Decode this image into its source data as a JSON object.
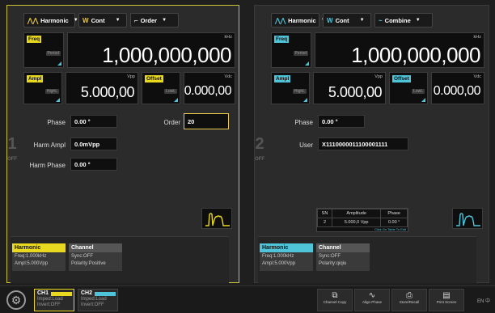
{
  "ch1": {
    "number": "1",
    "state": "OFF",
    "menus": {
      "waveform": "Harmonic",
      "mode": "Cont",
      "type": "Order"
    },
    "freq": {
      "tag": "Freq",
      "mini": "Period",
      "unit": "kHz",
      "value": "1,000,000,000"
    },
    "ampl": {
      "tag": "Ampl",
      "mini": "HighL",
      "unit": "Vpp",
      "value": "5.000,00"
    },
    "offset": {
      "tag": "Offset",
      "mini": "LowL",
      "unit": "Vdc",
      "value": "0.000,00"
    },
    "phase": {
      "label": "Phase",
      "value": "0.00 °"
    },
    "order": {
      "label": "Order",
      "value": "20"
    },
    "harm_ampl": {
      "label": "Harm Ampl",
      "value": "0.0mVpp"
    },
    "harm_phase": {
      "label": "Harm Phase",
      "value": "0.00 °"
    },
    "tab1": {
      "title": "Harmonic",
      "l1": "Freq:1.000kHz",
      "l2": "Ampl:5.000Vpp"
    },
    "tab2": {
      "title": "Channel",
      "l1": "Sync:OFF",
      "l2": "Polarity:Positive"
    }
  },
  "ch2": {
    "number": "2",
    "state": "OFF",
    "menus": {
      "waveform": "Harmonic",
      "mode": "Cont",
      "type": "Combine"
    },
    "freq": {
      "tag": "Freq",
      "mini": "Period",
      "unit": "kHz",
      "value": "1,000,000,000"
    },
    "ampl": {
      "tag": "Ampl",
      "mini": "HighL",
      "unit": "Vpp",
      "value": "5.000,00"
    },
    "offset": {
      "tag": "Offset",
      "mini": "LowL",
      "unit": "Vdc",
      "value": "0.000,00"
    },
    "phase": {
      "label": "Phase",
      "value": "0.00 °"
    },
    "user": {
      "label": "User",
      "value": "X1110000011100001111"
    },
    "table": {
      "headers": [
        "SN",
        "Amplitude",
        "Phase"
      ],
      "row": [
        "2",
        "5.000,0 Vpp",
        "0.00 °"
      ],
      "footer": "Click On Table To Edit"
    },
    "tab1": {
      "title": "Harmonic",
      "l1": "Freq:1.000kHz",
      "l2": "Ampl:5.000Vpp"
    },
    "tab2": {
      "title": "Channel",
      "l1": "Sync:OFF",
      "l2": "Polarity:qiqiu"
    }
  },
  "bottom": {
    "ch1": {
      "title": "CH1",
      "l1": "Imped:Load",
      "l2": "Invert:OFF"
    },
    "ch2": {
      "title": "CH2",
      "l1": "Imped:Load",
      "l2": "Invert:OFF"
    },
    "tools": [
      "Channel Copy",
      "Align Phase",
      "Store/Recall",
      "Print Screen"
    ],
    "lang": "EN  中"
  },
  "colors": {
    "ch1_accent": "#e8d81f",
    "ch2_accent": "#4fc3d8"
  }
}
